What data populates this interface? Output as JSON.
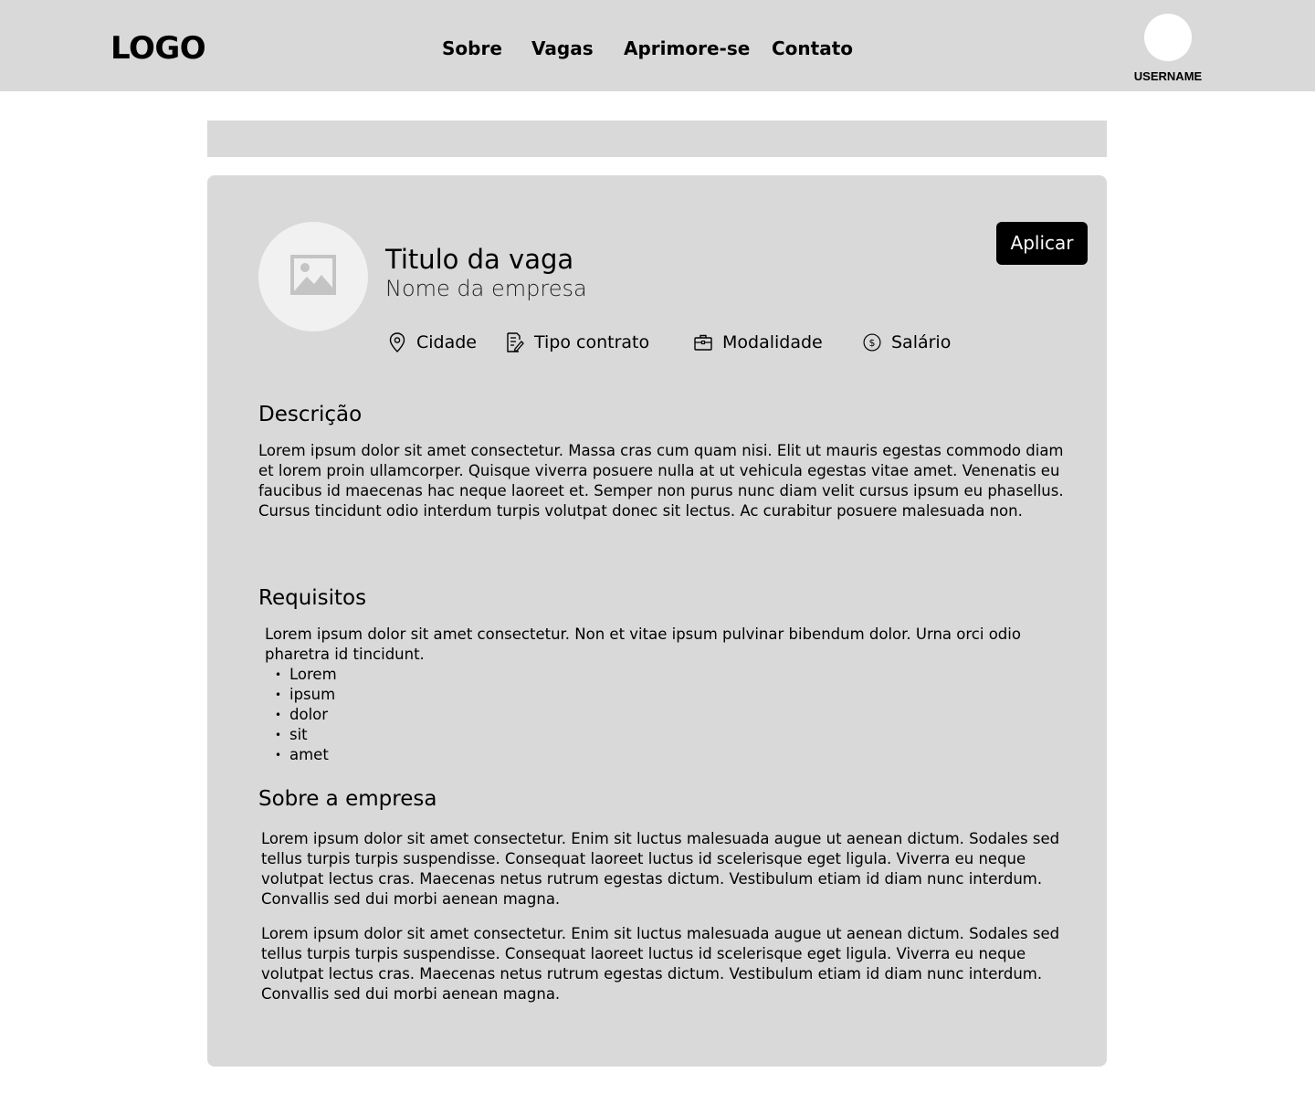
{
  "header": {
    "logo": "LOGO",
    "nav": {
      "sobre": "Sobre",
      "vagas": "Vagas",
      "aprimore": "Aprimore-se",
      "contato": "Contato"
    },
    "username": "USERNAME"
  },
  "job": {
    "title": "Titulo da vaga",
    "company": "Nome da empresa",
    "apply_label": "Aplicar",
    "meta": {
      "cidade": "Cidade",
      "tipo_contrato": "Tipo contrato",
      "modalidade": "Modalidade",
      "salario": "Salário"
    },
    "icons": {
      "company_logo": "image-placeholder-icon",
      "cidade": "map-pin-icon",
      "tipo_contrato": "document-edit-icon",
      "modalidade": "briefcase-icon",
      "salario": "dollar-circle-icon"
    }
  },
  "sections": {
    "descricao": {
      "title": "Descrição",
      "text": "Lorem ipsum dolor sit amet consectetur. Massa cras cum quam nisi. Elit ut mauris egestas commodo diam et lorem proin ullamcorper. Quisque viverra posuere nulla at ut vehicula egestas vitae amet. Venenatis eu faucibus id maecenas hac neque laoreet et. Semper non purus nunc diam velit cursus ipsum eu phasellus. Cursus tincidunt odio interdum turpis volutpat donec sit lectus. Ac curabitur posuere malesuada non."
    },
    "requisitos": {
      "title": "Requisitos",
      "text": "Lorem ipsum dolor sit amet consectetur. Non et vitae ipsum pulvinar bibendum dolor. Urna orci odio pharetra id tincidunt.",
      "items": [
        "Lorem",
        "ipsum",
        "dolor",
        "sit",
        "amet"
      ]
    },
    "sobre_empresa": {
      "title": "Sobre a empresa",
      "paragraphs": [
        "Lorem ipsum dolor sit amet consectetur. Enim sit luctus malesuada augue ut aenean dictum. Sodales sed tellus turpis turpis suspendisse. Consequat laoreet luctus id scelerisque eget ligula. Viverra eu neque volutpat lectus cras. Maecenas netus rutrum egestas dictum. Vestibulum etiam id diam nunc interdum. Convallis sed dui morbi aenean magna.",
        "Lorem ipsum dolor sit amet consectetur. Enim sit luctus malesuada augue ut aenean dictum. Sodales sed tellus turpis turpis suspendisse. Consequat laoreet luctus id scelerisque eget ligula. Viverra eu neque volutpat lectus cras. Maecenas netus rutrum egestas dictum. Vestibulum etiam id diam nunc interdum. Convallis sed dui morbi aenean magna."
      ]
    }
  },
  "colors": {
    "panel": "#d9d9d9",
    "page": "#ffffff",
    "button": "#000000",
    "logo_circle": "#f1f1f1",
    "placeholder_icon": "#c4c4c4"
  }
}
